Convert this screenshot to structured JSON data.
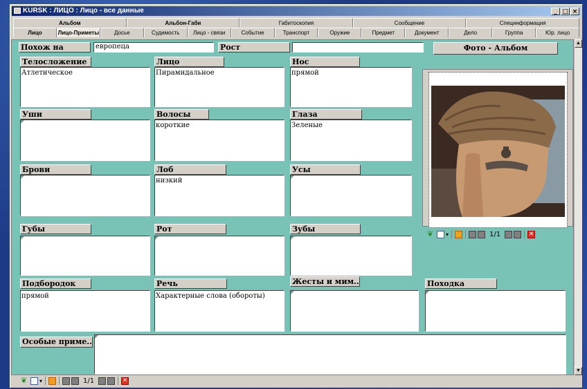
{
  "window": {
    "title": "KURSK : ЛИЦО : Лицо - все данные"
  },
  "tabs_top": [
    "Альбом",
    "Альбон-Габи",
    "Габитоскопия",
    "Сообщение",
    "Специнформация"
  ],
  "tabs_bottom": [
    "Лицо",
    "Лицо-Приметы",
    "Досье",
    "Судимость",
    "Лицо - связи",
    "Событие",
    "Транспорт",
    "Оружие",
    "Предмет",
    "Документ",
    "Дело",
    "Группа",
    "Юр. лицо"
  ],
  "form": {
    "pohozh_na": {
      "label": "Похож на",
      "value": "европеца"
    },
    "rost": {
      "label": "Рост",
      "value": ""
    },
    "photo_button": "Фото - Альбом",
    "telo": {
      "label": "Телосложение",
      "value": "Атлетическое"
    },
    "litso": {
      "label": "Лицо",
      "value": "Пирамидальное"
    },
    "nos": {
      "label": "Нос",
      "value": "прямой"
    },
    "ushi": {
      "label": "Уши",
      "value": ""
    },
    "volosy": {
      "label": "Волосы",
      "value": "короткие"
    },
    "glaza": {
      "label": "Глаза",
      "value": "Зеленые"
    },
    "brovi": {
      "label": "Брови",
      "value": ""
    },
    "lob": {
      "label": "Лоб",
      "value": "низкий"
    },
    "usy": {
      "label": "Усы",
      "value": ""
    },
    "guby": {
      "label": "Губы",
      "value": ""
    },
    "rot": {
      "label": "Рот",
      "value": ""
    },
    "zuby": {
      "label": "Зубы",
      "value": ""
    },
    "podborodok": {
      "label": "Подбородок",
      "value": "прямой"
    },
    "rech": {
      "label": "Речь",
      "value": "Характерные слова (обороты)"
    },
    "zhesty": {
      "label": "Жесты и мим...",
      "value": ""
    },
    "pokhodka": {
      "label": "Походка",
      "value": ""
    },
    "osobye": {
      "label": "Особые приме...",
      "value": ""
    }
  },
  "photo_nav": {
    "counter": "1/1"
  },
  "bottom_nav": {
    "counter": "1/1"
  }
}
